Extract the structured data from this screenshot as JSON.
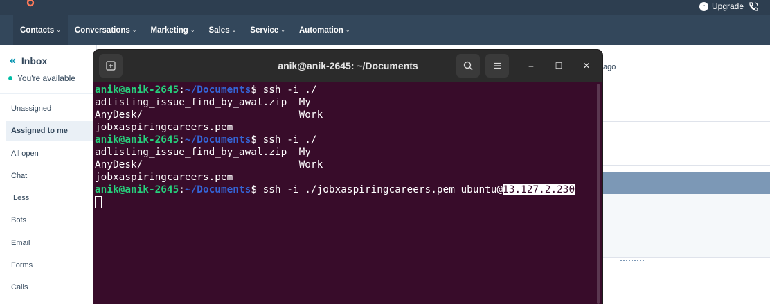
{
  "topbar": {
    "upgrade_label": "Upgrade"
  },
  "nav": {
    "items": [
      {
        "label": "Contacts"
      },
      {
        "label": "Conversations"
      },
      {
        "label": "Marketing"
      },
      {
        "label": "Sales"
      },
      {
        "label": "Service"
      },
      {
        "label": "Automation"
      }
    ]
  },
  "sidebar": {
    "title": "Inbox",
    "availability": "You're available",
    "items": [
      {
        "label": "Unassigned"
      },
      {
        "label": "Assigned to me"
      },
      {
        "label": "All open"
      },
      {
        "label": "Chat"
      },
      {
        "label": "Less"
      },
      {
        "label": "Bots"
      },
      {
        "label": "Email"
      },
      {
        "label": "Forms"
      },
      {
        "label": "Calls"
      }
    ]
  },
  "background": {
    "ago_text": "ago"
  },
  "terminal": {
    "title": "anik@anik-2645: ~/Documents",
    "prompt_user": "anik@anik-2645",
    "prompt_path": "~/Documents",
    "lines": [
      {
        "kind": "prompt",
        "cmd": "$ ssh -i ./"
      },
      {
        "kind": "out",
        "text": "adlisting_issue_find_by_awal.zip  My"
      },
      {
        "kind": "out",
        "text": "AnyDesk/                          Work"
      },
      {
        "kind": "out",
        "text": "jobxaspiringcareers.pem"
      },
      {
        "kind": "prompt",
        "cmd": "$ ssh -i ./"
      },
      {
        "kind": "out",
        "text": "adlisting_issue_find_by_awal.zip  My"
      },
      {
        "kind": "out",
        "text": "AnyDesk/                          Work"
      },
      {
        "kind": "out",
        "text": "jobxaspiringcareers.pem"
      },
      {
        "kind": "prompt",
        "cmd": "$ ssh -i ./jobxaspiringcareers.pem ubuntu@",
        "highlight": "13.127.2.230"
      }
    ]
  }
}
